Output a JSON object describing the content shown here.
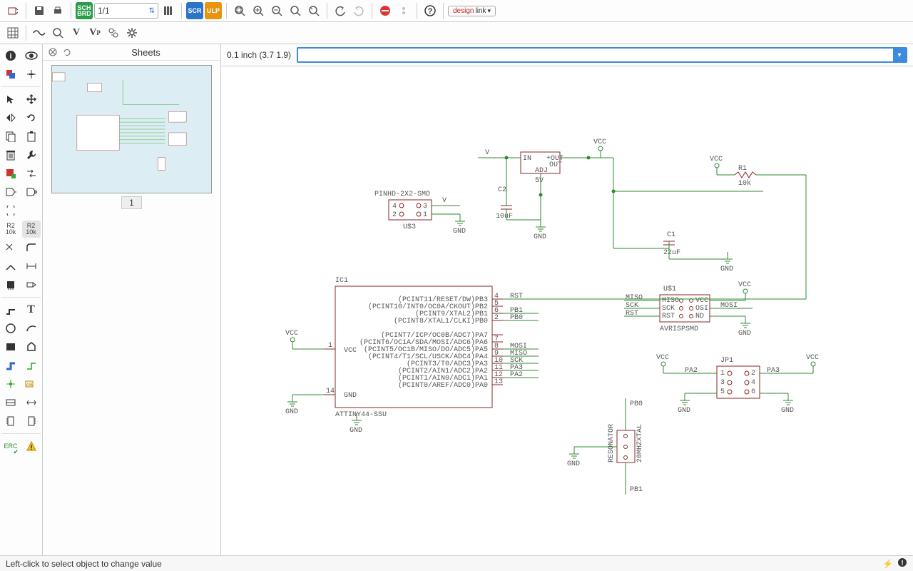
{
  "toolbar": {
    "page_value": "1/1",
    "sch_brd_label": "SCH\nBRD",
    "scr_label": "SCR",
    "ulp_label": "ULP",
    "designlink_a": "design",
    "designlink_b": "link"
  },
  "second_toolbar": {
    "v_label": "V",
    "vp_label": "V",
    "vp_sub": "P"
  },
  "left_tools": {
    "r2_10k_a": "R2\n10k",
    "r2_10k_b": "R2\n10k",
    "erc_label": "ERC"
  },
  "sheets": {
    "title": "Sheets",
    "thumb_label": "1"
  },
  "canvas": {
    "coord_label": "0.1 inch (3.7 1.9)"
  },
  "schematic": {
    "ic1": {
      "ref": "IC1",
      "value": "ATTINY44-SSU",
      "vcc_pin": "VCC",
      "gnd_pin": "GND",
      "pin_1": "1",
      "pin_14": "14",
      "pins_right_nums": [
        "4",
        "5",
        "6",
        "2",
        "",
        "7",
        "8",
        "9",
        "10",
        "11",
        "12",
        "13"
      ],
      "pins_right_labels": [
        "(PCINT11/RESET/DW)PB3",
        "(PCINT10/INT0/OC0A/CKOUT)PB2",
        "(PCINT9/XTAL2)PB1",
        "(PCINT8/XTAL1/CLKI)PB0",
        "(PCINT7/ICP/OC0B/ADC7)PA7",
        "(PCINT6/OC1A/SDA/MOSI/ADC6)PA6",
        "(PCINT5/OC1B/MISO/DO/ADC5)PA5",
        "(PCINT4/T1/SCL/USCK/ADC4)PA4",
        "(PCINT3/T0/ADC3)PA3",
        "(PCINT2/AIN1/ADC2)PA2",
        "(PCINT1/AIN0/ADC1)PA1",
        "(PCINT0/AREF/ADC0)PA0"
      ],
      "right_nets": [
        "RST",
        "",
        "PB1",
        "PB0",
        "",
        "",
        "MOSI",
        "MISO",
        "SCK",
        "PA3",
        "PA2",
        ""
      ]
    },
    "reg": {
      "in": "IN",
      "out": "+OUT",
      "out2": "OUT",
      "adj": "ADJ",
      "value": "5V"
    },
    "pinhd": {
      "ref": "PINHD-2X2-SMD",
      "value": "U$3",
      "p1": "1",
      "p2": "2",
      "p3": "3",
      "p4": "4"
    },
    "c2": {
      "ref": "C2",
      "value": "10uF"
    },
    "c1": {
      "ref": "C1",
      "value": "22uF"
    },
    "r1": {
      "ref": "R1",
      "value": "10k"
    },
    "isp": {
      "ref": "U$1",
      "value": "AVRISPSMD",
      "l1": "MISO",
      "l2": "SCK",
      "l3": "RST",
      "pad_l1": "MISO",
      "pad_l2": "SCK",
      "pad_l3": "RST",
      "pad_r1": "VCC",
      "pad_r2": "OSI",
      "pad_r3": "ND",
      "r1": "MOSI"
    },
    "jp1": {
      "ref": "JP1",
      "p1": "1",
      "p2": "2",
      "p3": "3",
      "p4": "4",
      "p5": "5",
      "p6": "6",
      "left_net": "PA2",
      "right_net": "PA3"
    },
    "xtal": {
      "ref": "RESONATOR",
      "value": "20MHZXTAL",
      "net_top": "PB0",
      "net_bot": "PB1"
    },
    "pwr": {
      "vcc": "VCC",
      "gnd": "GND",
      "v": "V"
    }
  },
  "status": {
    "hint": "Left-click to select object to change value"
  }
}
